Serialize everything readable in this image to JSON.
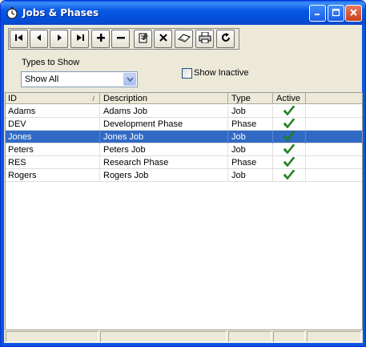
{
  "window": {
    "title": "Jobs & Phases",
    "icon": "stopwatch-icon",
    "controls": [
      "minimize-icon",
      "maximize-icon",
      "close-icon"
    ]
  },
  "toolbar": {
    "buttons": [
      {
        "name": "first-record",
        "icon": "first-icon"
      },
      {
        "name": "previous-record",
        "icon": "previous-icon"
      },
      {
        "name": "next-record",
        "icon": "next-icon"
      },
      {
        "name": "last-record",
        "icon": "last-icon"
      },
      {
        "name": "add-record",
        "icon": "plus-icon"
      },
      {
        "name": "remove-record",
        "icon": "minus-icon"
      },
      {
        "name": "edit-record",
        "icon": "edit-icon"
      },
      {
        "name": "cancel-record",
        "icon": "x-icon"
      },
      {
        "name": "erase",
        "icon": "eraser-icon"
      },
      {
        "name": "print",
        "icon": "printer-icon"
      },
      {
        "name": "refresh",
        "icon": "refresh-icon"
      }
    ]
  },
  "filters": {
    "types_label": "Types to Show",
    "types_value": "Show All",
    "show_inactive_label": "Show Inactive",
    "show_inactive_checked": false
  },
  "grid": {
    "columns": [
      "ID",
      "Description",
      "Type",
      "Active"
    ],
    "sort_indicator": "/",
    "rows": [
      {
        "id": "Adams",
        "description": "Adams Job",
        "type": "Job",
        "active": true,
        "selected": false
      },
      {
        "id": "DEV",
        "description": "Development Phase",
        "type": "Phase",
        "active": true,
        "selected": false
      },
      {
        "id": "Jones",
        "description": "Jones Job",
        "type": "Job",
        "active": true,
        "selected": true
      },
      {
        "id": "Peters",
        "description": "Peters Job",
        "type": "Job",
        "active": true,
        "selected": false
      },
      {
        "id": "RES",
        "description": "Research Phase",
        "type": "Phase",
        "active": true,
        "selected": false
      },
      {
        "id": "Rogers",
        "description": "Rogers Job",
        "type": "Job",
        "active": true,
        "selected": false
      }
    ]
  },
  "colors": {
    "selection": "#316ac5",
    "check": "#1f8f1f",
    "title_bar": "#0858e5"
  }
}
